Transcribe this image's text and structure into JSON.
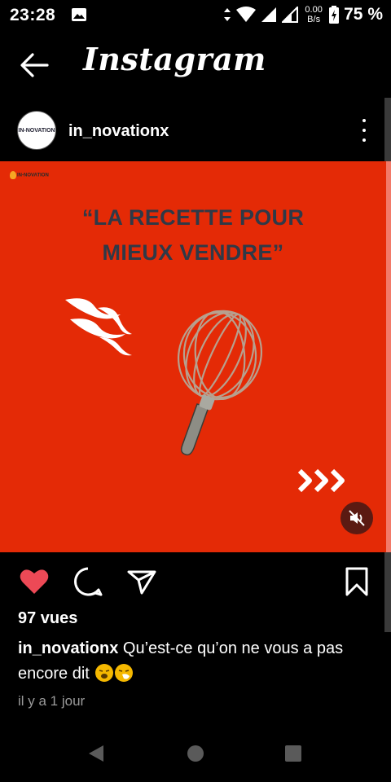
{
  "status_bar": {
    "time": "23:28",
    "net_speed_value": "0.00",
    "net_speed_unit": "B/s",
    "battery": "75 %",
    "icons": [
      "image-icon",
      "data-arrows-icon",
      "wifi-icon",
      "signal-icon",
      "signal-icon",
      "battery-charging-icon"
    ]
  },
  "header": {
    "app_title": "Instagram"
  },
  "post": {
    "username": "in_novationx",
    "avatar_text": "IN-NOVATION",
    "media": {
      "brand_text": "IN-NOVATION",
      "headline_line1": "“LA RECETTE POUR",
      "headline_line2": "MIEUX VENDRE”",
      "background_color": "#e42a06",
      "headline_color": "#2f3947",
      "muted": true
    },
    "liked": true,
    "views": "97 vues",
    "caption_user": "in_novationx",
    "caption_text": "Qu’est-ce qu’on ne vous a pas encore dit",
    "caption_emojis": [
      "weary-face-icon",
      "sneezing-face-icon"
    ],
    "time_ago": "il y a 1 jour"
  },
  "colors": {
    "like_red": "#ed4956",
    "background": "#000000"
  }
}
